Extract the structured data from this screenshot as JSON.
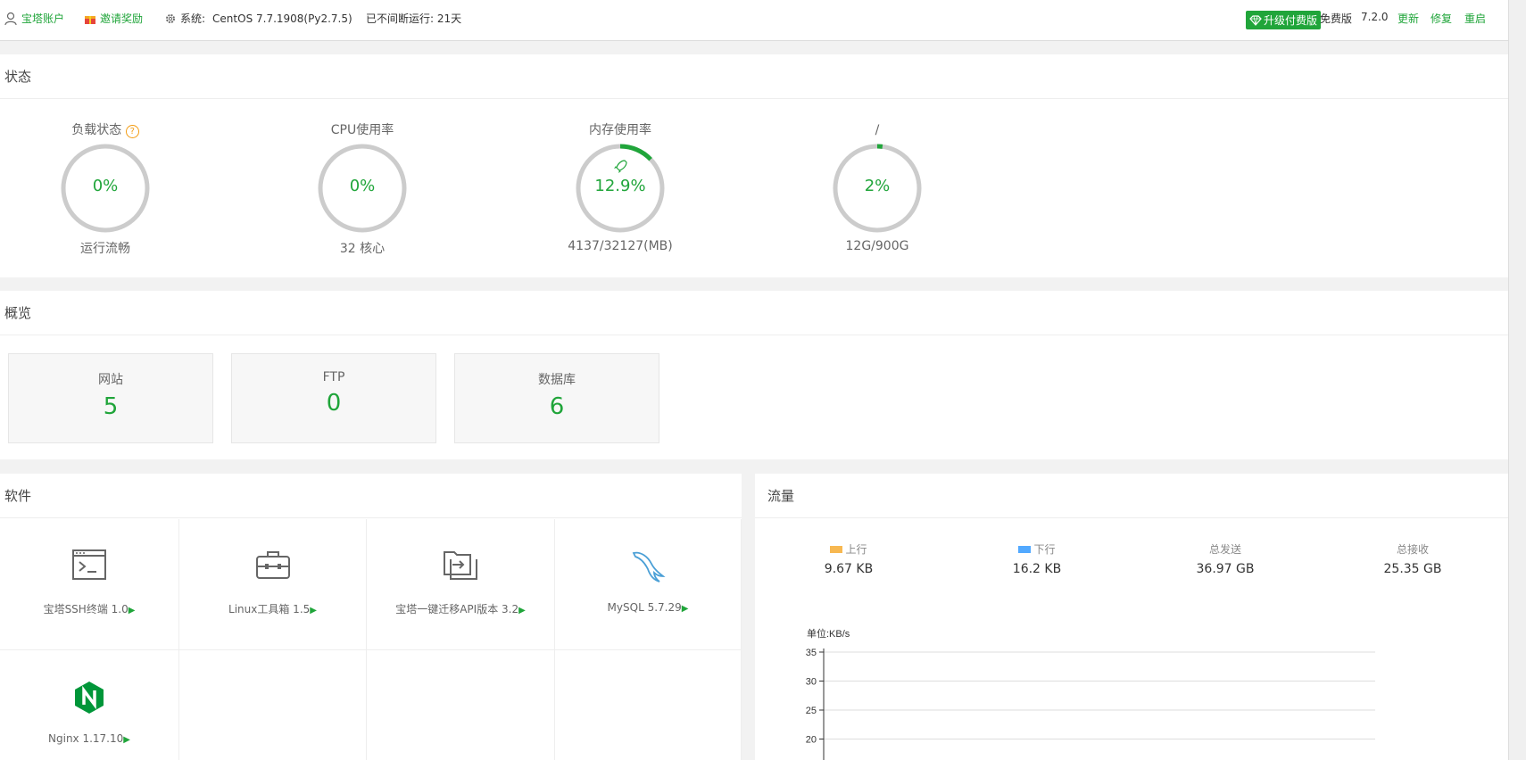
{
  "topbar": {
    "account": "宝塔账户",
    "invite": "邀请奖励",
    "system_label": "系统:",
    "system_value": "CentOS 7.7.1908(Py2.7.5)",
    "uptime": "已不间断运行: 21天",
    "upgrade": "升级付费版",
    "edition": "免费版",
    "version": "7.2.0",
    "update": "更新",
    "repair": "修复",
    "restart": "重启"
  },
  "status": {
    "title": "状态",
    "gauges": [
      {
        "label": "负载状态",
        "pct": "0%",
        "value": 0,
        "sub": "运行流畅",
        "help": "?"
      },
      {
        "label": "CPU使用率",
        "pct": "0%",
        "value": 0,
        "sub": "32 核心"
      },
      {
        "label": "内存使用率",
        "pct": "12.9%",
        "value": 12.9,
        "sub": "4137/32127(MB)"
      },
      {
        "label": "/",
        "pct": "2%",
        "value": 2,
        "sub": "12G/900G"
      }
    ]
  },
  "overview": {
    "title": "概览",
    "boxes": [
      {
        "name": "网站",
        "value": "5"
      },
      {
        "name": "FTP",
        "value": "0"
      },
      {
        "name": "数据库",
        "value": "6"
      }
    ]
  },
  "software": {
    "title": "软件",
    "items": [
      {
        "name": "宝塔SSH终端 1.0",
        "icon": "terminal-icon"
      },
      {
        "name": "Linux工具箱 1.5",
        "icon": "toolbox-icon"
      },
      {
        "name": "宝塔一键迁移API版本 3.2",
        "icon": "migrate-icon"
      },
      {
        "name": "MySQL 5.7.29",
        "icon": "mysql-dolphin-icon"
      },
      {
        "name": "Nginx 1.17.10",
        "icon": "nginx-icon"
      }
    ],
    "arrow": "▶"
  },
  "traffic": {
    "title": "流量",
    "stats": [
      {
        "key": "上行",
        "value": "9.67 KB",
        "color": "#f7b851"
      },
      {
        "key": "下行",
        "value": "16.2 KB",
        "color": "#52a9ff"
      },
      {
        "key": "总发送",
        "value": "36.97 GB"
      },
      {
        "key": "总接收",
        "value": "25.35 GB"
      }
    ]
  },
  "chart_data": {
    "type": "line",
    "ylabel": "单位:KB/s",
    "y_ticks": [
      "35",
      "30",
      "25",
      "20"
    ],
    "y_tick_values": [
      35,
      30,
      25,
      20
    ],
    "series": []
  },
  "colors": {
    "accent": "#20a53a",
    "ring_bg": "#ccc"
  }
}
